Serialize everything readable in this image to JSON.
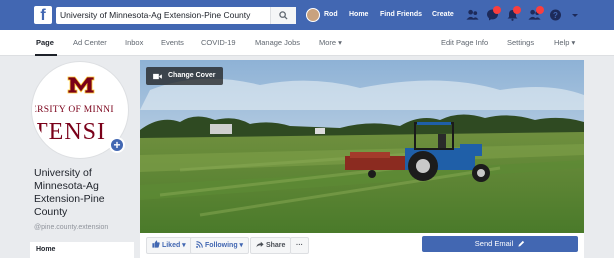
{
  "topbar": {
    "search_value": "University of Minnesota-Ag Extension-Pine County",
    "user_name": "Rod",
    "home": "Home",
    "find_friends": "Find Friends",
    "create": "Create"
  },
  "subnav": {
    "items": [
      "Page",
      "Ad Center",
      "Inbox",
      "Events",
      "COVID-19",
      "Manage Jobs",
      "More ▾"
    ],
    "right_items": [
      "Edit Page Info",
      "Settings",
      "Help ▾"
    ]
  },
  "profile": {
    "logo_line1": "ERSITY OF MINNI",
    "logo_line2": "TENSI",
    "page_name": "University of Minnesota-Ag Extension-Pine County",
    "handle": "@pine.county.extension",
    "menu_first": "Home"
  },
  "cover": {
    "change_cover_label": "Change Cover"
  },
  "actions": {
    "liked": "Liked ▾",
    "following": "Following ▾",
    "share": "Share",
    "more": "···",
    "send_email": "Send Email"
  },
  "colors": {
    "brand": "#4267b2",
    "maroon": "#7a0019",
    "gold": "#ffcc33"
  }
}
